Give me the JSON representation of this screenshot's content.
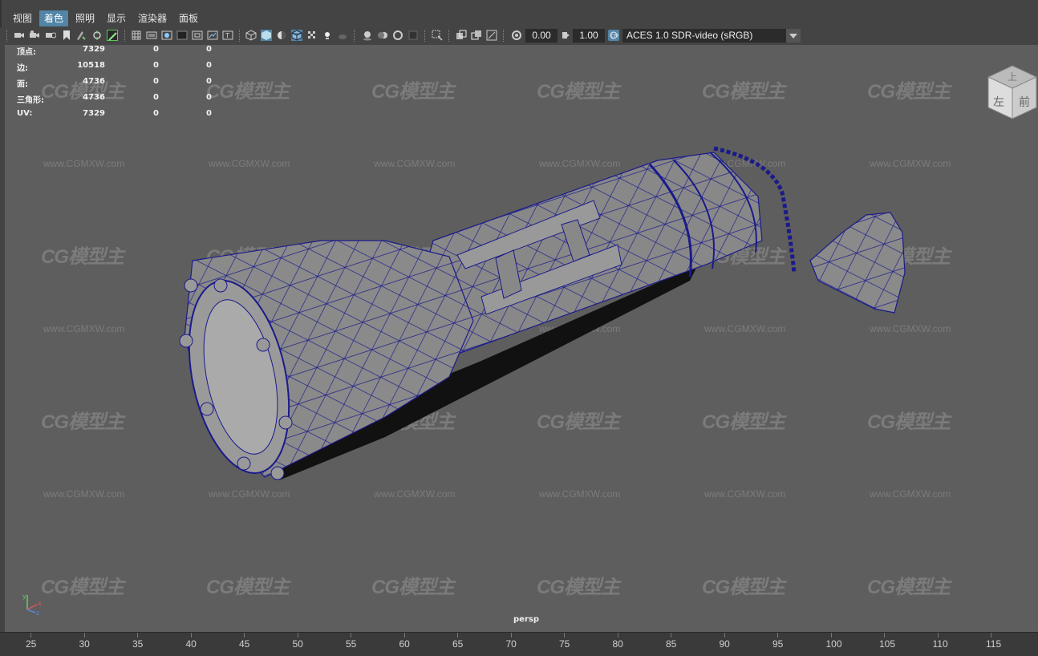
{
  "menu": [
    "视图",
    "着色",
    "照明",
    "显示",
    "渲染器",
    "面板"
  ],
  "menu_active_index": 1,
  "toolbar": {
    "exposure": "0.00",
    "gamma": "1.00",
    "color_space": "ACES 1.0 SDR-video (sRGB)",
    "icons": [
      "camera-select-icon",
      "camera-attr-icon",
      "bookmark-icon",
      "image-plane-icon",
      "grid-icon",
      "film-gate-icon",
      "resolution-gate-icon",
      "gate-mask-icon",
      "field-chart-icon",
      "safe-action-icon",
      "safe-title-icon",
      "wireframe-icon",
      "smooth-shade-icon",
      "default-material-icon",
      "wireframe-on-shaded-icon",
      "textured-icon",
      "use-all-lights-icon",
      "shadows-icon",
      "screen-space-ao-icon",
      "motion-blur-icon",
      "anti-aliasing-icon",
      "depth-of-field-icon",
      "isolate-select-icon",
      "xray-icon",
      "xray-joints-icon",
      "xray-components-icon",
      "exposure-icon",
      "gamma-icon",
      "color-management-icon"
    ]
  },
  "hud": {
    "rows": [
      {
        "label": "顶点:",
        "values": [
          "7329",
          "0",
          "0"
        ]
      },
      {
        "label": "边:",
        "values": [
          "10518",
          "0",
          "0"
        ]
      },
      {
        "label": "面:",
        "values": [
          "4736",
          "0",
          "0"
        ]
      },
      {
        "label": "三角形:",
        "values": [
          "4736",
          "0",
          "0"
        ]
      },
      {
        "label": "UV:",
        "values": [
          "7329",
          "0",
          "0"
        ]
      }
    ]
  },
  "view_cube": {
    "top": "上",
    "left": "左",
    "front": "前"
  },
  "camera_name": "persp",
  "watermark": {
    "logo": "CG模型主",
    "url": "www.CGMXW.com"
  },
  "axis_labels": {
    "x": "x",
    "y": "y",
    "z": "z"
  },
  "ruler": [
    "25",
    "30",
    "35",
    "40",
    "45",
    "50",
    "55",
    "60",
    "65",
    "70",
    "75",
    "80",
    "85",
    "90",
    "95",
    "100",
    "105",
    "110",
    "115"
  ],
  "colors": {
    "wire": "#1a1a8c",
    "active_menu": "#5285a6",
    "viewport_bg": "#5e5e5e"
  }
}
